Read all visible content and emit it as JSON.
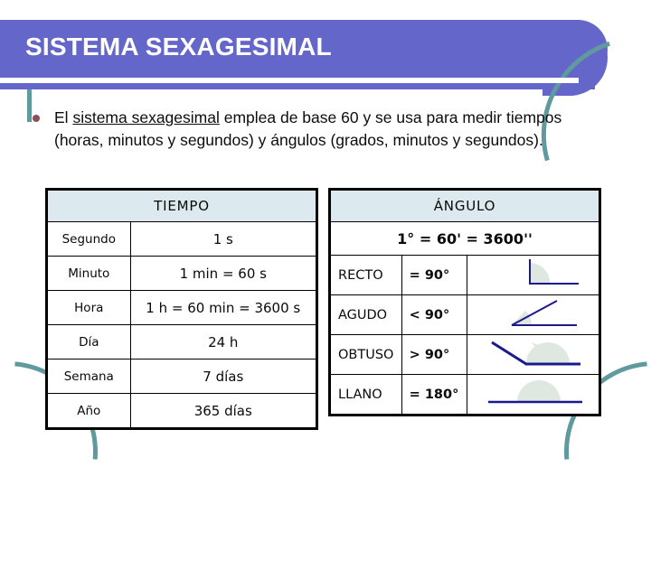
{
  "slide": {
    "title": "SISTEMA SEXAGESIMAL",
    "accent_purple": "#6467c9",
    "accent_teal": "#5f9a9e",
    "table_header_blue": "#dceaf0",
    "bullet_color": "#8d4f55",
    "diagram_line_color": "#1a1a8c",
    "diagram_arc_fill": "#dfe8e0"
  },
  "body": {
    "bullet": {
      "marker": "bullet-dot",
      "text_before": "El ",
      "text_underlined": "sistema sexagesimal",
      "text_after": " emplea de base 60 y se usa para medir tiempos (horas, minutos y segundos) y ángulos (grados, minutos y segundos)."
    }
  },
  "tiempo_table": {
    "header": "TIEMPO",
    "rows": [
      {
        "unit": "Segundo",
        "equivalence": "1 s"
      },
      {
        "unit": "Minuto",
        "equivalence": "1 min = 60 s"
      },
      {
        "unit": "Hora",
        "equivalence": "1 h = 60 min = 3600 s"
      },
      {
        "unit": "Día",
        "equivalence": "24 h"
      },
      {
        "unit": "Semana",
        "equivalence": "7 días"
      },
      {
        "unit": "Año",
        "equivalence": "365 días"
      }
    ]
  },
  "angulo_table": {
    "header": "ÁNGULO",
    "conversion": "1° = 60' = 3600''",
    "rows": [
      {
        "name": "RECTO",
        "value": "= 90°",
        "diagram": "right-angle-diagram"
      },
      {
        "name": "AGUDO",
        "value": "< 90°",
        "diagram": "acute-angle-diagram"
      },
      {
        "name": "OBTUSO",
        "value": "> 90°",
        "diagram": "obtuse-angle-diagram"
      },
      {
        "name": "LLANO",
        "value": "= 180°",
        "diagram": "straight-angle-diagram"
      }
    ]
  }
}
